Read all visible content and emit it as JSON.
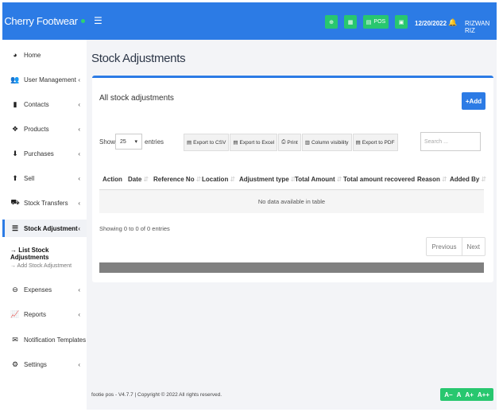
{
  "app": {
    "brand": "Cherry Footwear"
  },
  "header": {
    "pos_label": "POS",
    "date": "12/20/2022",
    "user": "RIZWAN RIZ"
  },
  "sidebar": {
    "items": [
      {
        "label": "Home",
        "icon": "tachometer-icon"
      },
      {
        "label": "User Management",
        "icon": "users-icon"
      },
      {
        "label": "Contacts",
        "icon": "address-book-icon"
      },
      {
        "label": "Products",
        "icon": "cubes-icon"
      },
      {
        "label": "Purchases",
        "icon": "arrow-circle-down-icon"
      },
      {
        "label": "Sell",
        "icon": "arrow-circle-up-icon"
      },
      {
        "label": "Stock Transfers",
        "icon": "truck-icon"
      },
      {
        "label": "Stock Adjustment",
        "icon": "database-icon"
      },
      {
        "label": "Expenses",
        "icon": "minus-circle-icon"
      },
      {
        "label": "Reports",
        "icon": "chart-icon"
      },
      {
        "label": "Notification Templates",
        "icon": "envelope-icon"
      },
      {
        "label": "Settings",
        "icon": "cog-icon"
      }
    ],
    "sub_items": [
      {
        "label": "→ List Stock Adjustments"
      },
      {
        "label": "→ Add Stock Adjustment"
      }
    ]
  },
  "main": {
    "page_title": "Stock Adjustments",
    "card_title": "All stock adjustments",
    "add_button": "+Add",
    "show_label": "Show",
    "entries_value": "25",
    "entries_label": "entries",
    "export_buttons": [
      "Export to CSV",
      "Export to Excel",
      "Print",
      "Column visibility",
      "Export to PDF"
    ],
    "search_placeholder": "Search ...",
    "columns": [
      "Action",
      "Date",
      "Reference No",
      "Location",
      "Adjustment type",
      "Total Amount",
      "Total amount recovered",
      "Reason",
      "Added By"
    ],
    "empty_message": "No data available in table",
    "showing_text": "Showing 0 to 0 of 0 entries",
    "pager": {
      "prev": "Previous",
      "next": "Next"
    }
  },
  "footer": {
    "text": "footie pos - V4.7.7 | Copyright © 2022 All rights reserved.",
    "font_controls": [
      "A−",
      "A",
      "A+",
      "A++"
    ]
  },
  "colors": {
    "primary": "#2c7be5",
    "success": "#28c76f"
  }
}
